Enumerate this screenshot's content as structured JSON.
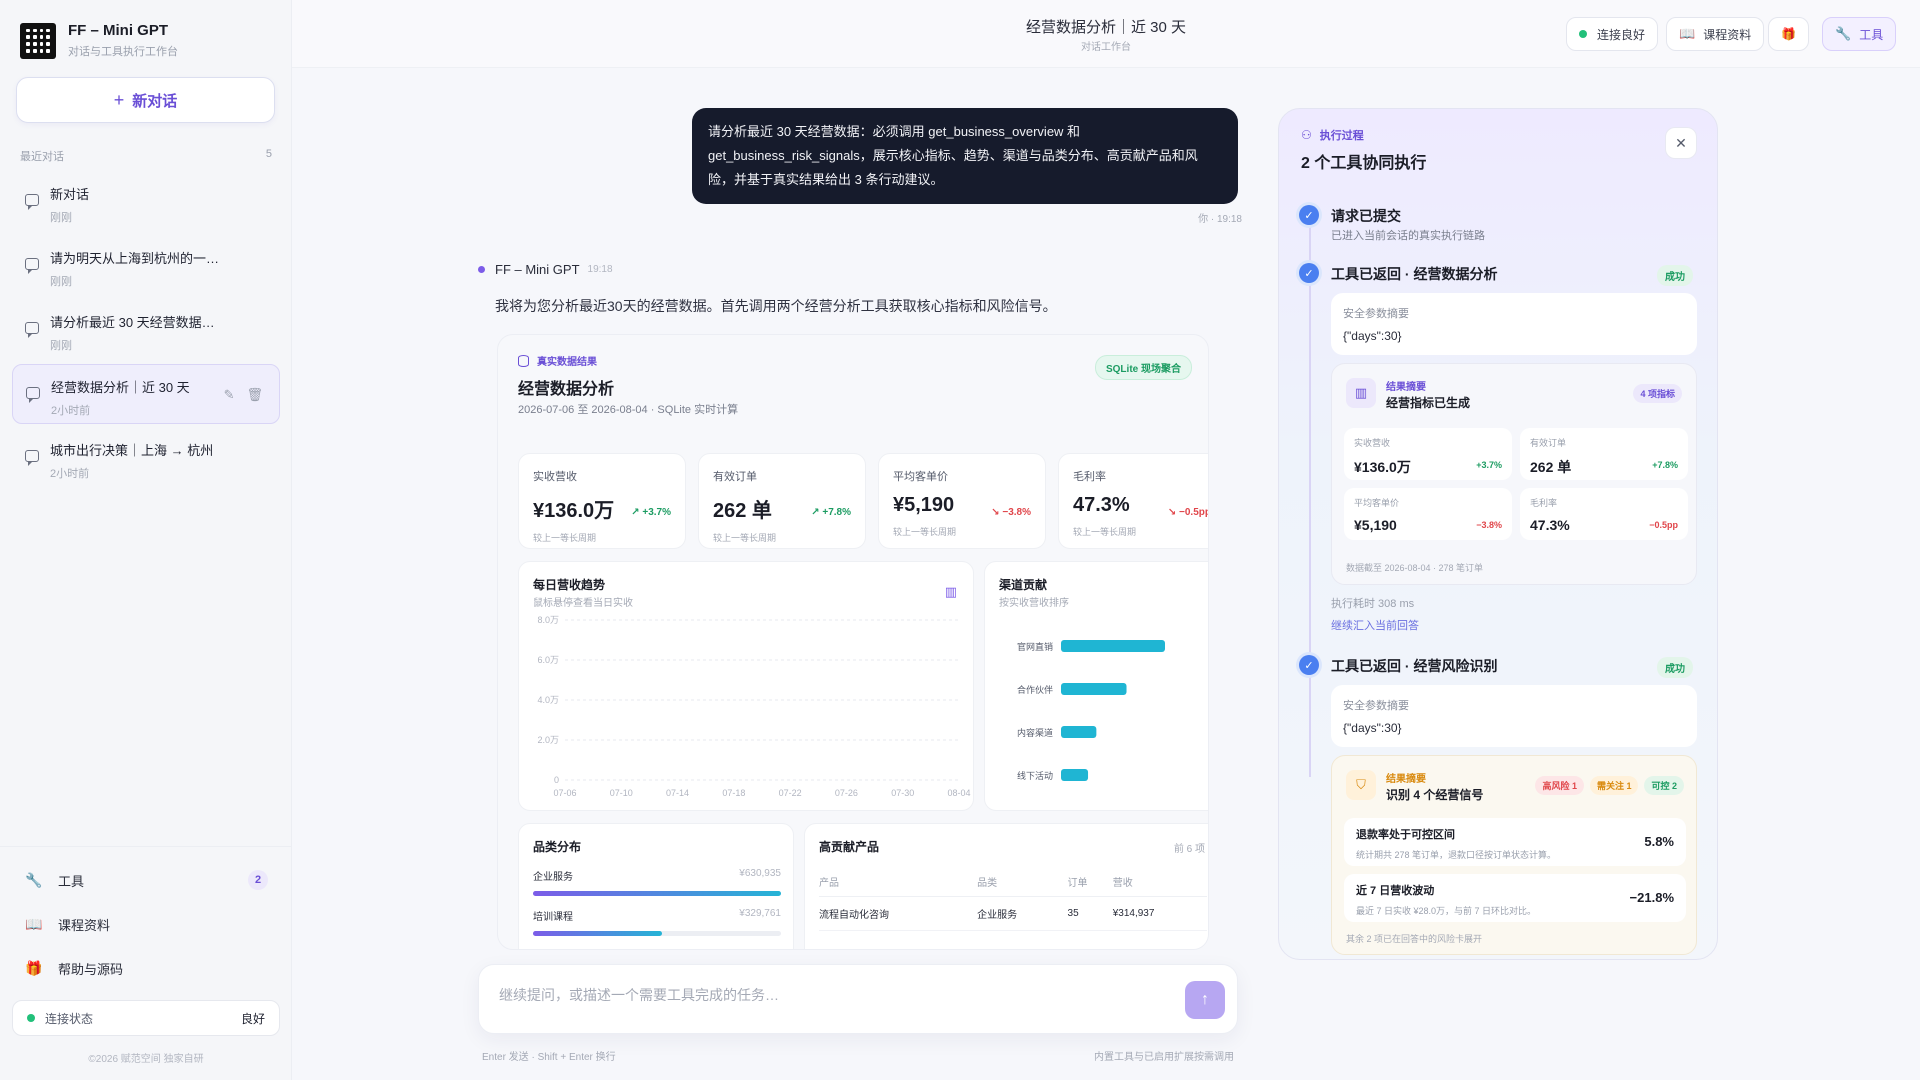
{
  "brand": {
    "title": "FF – Mini GPT",
    "subtitle": "对话与工具执行工作台"
  },
  "sidebar": {
    "new_chat_label": "新对话",
    "recent_label": "最近对话",
    "recent_count": "5",
    "conversations": [
      {
        "title": "新对话",
        "time": "刚刚",
        "active": false
      },
      {
        "title": "请为明天从上海到杭州的一…",
        "time": "刚刚",
        "active": false
      },
      {
        "title": "请分析最近 30 天经营数据…",
        "time": "刚刚",
        "active": false
      },
      {
        "title": "经营数据分析｜近 30 天",
        "time": "2小时前",
        "active": true
      },
      {
        "title": "城市出行决策｜上海 → 杭州",
        "time": "2小时前",
        "active": false
      }
    ],
    "nav": [
      {
        "label": "工具",
        "icon": "wrench-icon",
        "badge": "2"
      },
      {
        "label": "课程资料",
        "icon": "book-icon",
        "badge": ""
      },
      {
        "label": "帮助与源码",
        "icon": "gift-icon",
        "badge": ""
      }
    ],
    "connection_label": "连接状态",
    "connection_value": "良好",
    "copyright": "©2026 赋范空间 独家自研"
  },
  "header": {
    "title": "经营数据分析｜近 30 天",
    "subtitle": "对话工作台",
    "status_label": "连接良好",
    "course_label": "课程资料",
    "tools_label": "工具"
  },
  "chat": {
    "user_message": "请分析最近 30 天经营数据：必须调用 get_business_overview 和 get_business_risk_signals，展示核心指标、趋势、渠道与品类分布、高贡献产品和风险，并基于真实结果给出 3 条行动建议。",
    "user_meta": "你 · 19:18",
    "bot_name": "FF – Mini GPT",
    "bot_time": "19:18",
    "bot_text": "我将为您分析最近30天的经营数据。首先调用两个经营分析工具获取核心指标和风险信号。"
  },
  "card": {
    "tag": "真实数据结果",
    "title": "经营数据分析",
    "subtitle": "2026-07-06 至 2026-08-04 · SQLite 实时计算",
    "badge": "SQLite 现场聚合",
    "kpis": [
      {
        "label": "实收营收",
        "value": "¥136.0万",
        "delta": "↗ +3.7%",
        "dir": "up",
        "foot": "较上一等长周期"
      },
      {
        "label": "有效订单",
        "value": "262 单",
        "delta": "↗ +7.8%",
        "dir": "up",
        "foot": "较上一等长周期"
      },
      {
        "label": "平均客单价",
        "value": "¥5,190",
        "delta": "↘ −3.8%",
        "dir": "down",
        "foot": "较上一等长周期"
      },
      {
        "label": "毛利率",
        "value": "47.3%",
        "delta": "↘ −0.5pp",
        "dir": "down",
        "foot": "较上一等长周期"
      }
    ],
    "trend_title": "每日营收趋势",
    "trend_sub": "鼠标悬停查看当日实收",
    "channel_title": "渠道贡献",
    "channel_sub": "按实收营收排序",
    "category_title": "品类分布",
    "categories": [
      {
        "name": "企业服务",
        "value": "¥630,935",
        "share": 1.0
      },
      {
        "name": "培训课程",
        "value": "¥329,761",
        "share": 0.52
      }
    ],
    "products_title": "高贡献产品",
    "products_count": "前 6 项",
    "products_headers": [
      "产品",
      "品类",
      "订单",
      "营收"
    ],
    "products_rows": [
      [
        "流程自动化咨询",
        "企业服务",
        "35",
        "¥314,937"
      ]
    ]
  },
  "chart_data": [
    {
      "type": "line",
      "title": "每日营收趋势",
      "x": [
        "07-06",
        "07-10",
        "07-14",
        "07-18",
        "07-22",
        "07-26",
        "07-30",
        "08-04"
      ],
      "y_ticks": [
        "0",
        "2.0万",
        "4.0万",
        "6.0万",
        "8.0万"
      ],
      "ylim": [
        0,
        80000
      ],
      "grid": true,
      "series": []
    },
    {
      "type": "bar",
      "title": "渠道贡献",
      "categories": [
        "官网直销",
        "合作伙伴",
        "内容渠道",
        "线下活动"
      ],
      "values": [
        100,
        63,
        34,
        26
      ],
      "orientation": "horizontal",
      "color": "#1fb5d3"
    }
  ],
  "exec": {
    "tag": "执行过程",
    "title": "2 个工具协同执行",
    "step1_title": "请求已提交",
    "step1_sub": "已进入当前会话的真实执行链路",
    "step2_title": "工具已返回 · 经营数据分析",
    "ok_label": "成功",
    "param_label": "安全参数摘要",
    "param_value": "{\"days\":30}",
    "res_tag": "结果摘要",
    "res1_title": "经营指标已生成",
    "res1_badge": "4 项指标",
    "minis": [
      {
        "label": "实收营收",
        "value": "¥136.0万",
        "delta": "+3.7%",
        "dir": "up"
      },
      {
        "label": "有效订单",
        "value": "262 单",
        "delta": "+7.8%",
        "dir": "up"
      },
      {
        "label": "平均客单价",
        "value": "¥5,190",
        "delta": "−3.8%",
        "dir": "down"
      },
      {
        "label": "毛利率",
        "value": "47.3%",
        "delta": "−0.5pp",
        "dir": "down"
      }
    ],
    "res1_foot": "数据截至 2026-08-04 · 278 笔订单",
    "exec_time": "执行耗时 308 ms",
    "exec_link": "继续汇入当前回答",
    "step3_title": "工具已返回 · 经营风险识别",
    "res2_title": "识别 4 个经营信号",
    "risk_badges": [
      "高风险 1",
      "需关注 1",
      "可控 2"
    ],
    "signals": [
      {
        "title": "退款率处于可控区间",
        "desc": "统计期共 278 笔订单，退款口径按订单状态计算。",
        "value": "5.8%"
      },
      {
        "title": "近 7 日营收波动",
        "desc": "最近 7 日实收 ¥28.0万，与前 7 日环比对比。",
        "value": "−21.8%"
      }
    ],
    "sig_more": "其余 2 项已在回答中的风险卡展开"
  },
  "composer": {
    "placeholder": "继续提问，或描述一个需要工具完成的任务…",
    "hint_left": "Enter 发送 · Shift + Enter 换行",
    "hint_right": "内置工具与已启用扩展按需调用"
  }
}
